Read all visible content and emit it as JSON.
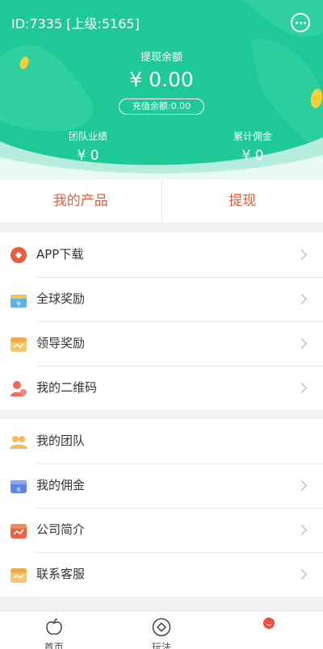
{
  "header": {
    "id_line": "ID:7335 [上级:5165]",
    "balance_label": "提现余额",
    "balance_amount": "¥ 0.00",
    "recharge_text": "充值余额:0.00",
    "team_label": "团队业绩",
    "team_value": "¥ 0",
    "commission_label": "累计佣金",
    "commission_value": "¥ 0",
    "bg_color": "#1fc997"
  },
  "actions": {
    "products": "我的产品",
    "withdraw": "提现"
  },
  "menu1": [
    {
      "label": "APP下载",
      "icon": "download-app-icon"
    },
    {
      "label": "全球奖励",
      "icon": "gift-box-icon"
    },
    {
      "label": "领导奖励",
      "icon": "calendar-icon"
    },
    {
      "label": "我的二维码",
      "icon": "user-heart-icon"
    }
  ],
  "menu2": [
    {
      "label": "我的团队",
      "icon": "team-icon"
    },
    {
      "label": "我的佣金",
      "icon": "wallet-icon"
    },
    {
      "label": "公司简介",
      "icon": "chart-calendar-icon"
    },
    {
      "label": "联系客服",
      "icon": "service-calendar-icon"
    }
  ],
  "tabbar": [
    {
      "label": "首页",
      "icon": "apple-home-icon"
    },
    {
      "label": "玩法",
      "icon": "diamond-circle-icon"
    },
    {
      "label": "",
      "icon": "smile-icon"
    }
  ],
  "colors": {
    "accent": "#d9603f",
    "brand_green": "#1fc997",
    "chevron": "#aaaaaa"
  }
}
